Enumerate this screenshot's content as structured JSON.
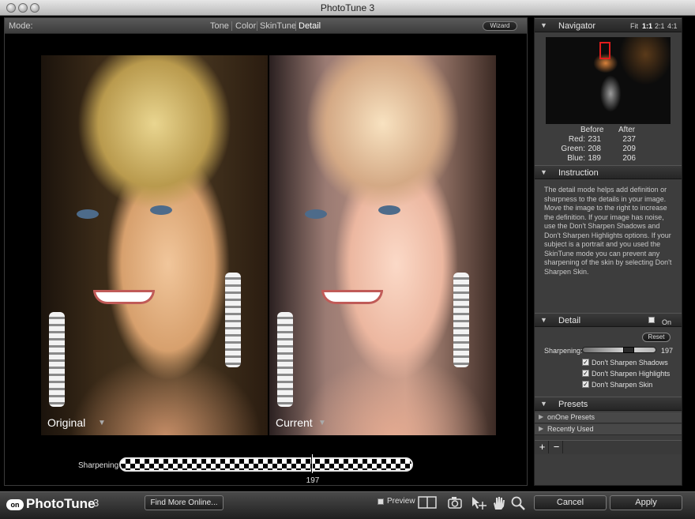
{
  "window": {
    "title": "PhotoTune 3"
  },
  "modebar": {
    "label": "Mode:",
    "tabs": [
      "Tone",
      "Color",
      "SkinTune",
      "Detail"
    ],
    "active_tab": "Detail",
    "wizard": "Wizard"
  },
  "photos": {
    "original_label": "Original",
    "current_label": "Current"
  },
  "slider": {
    "label": "Sharpening",
    "value": "197"
  },
  "navigator": {
    "title": "Navigator",
    "zoom": [
      "Fit",
      "1:1",
      "2:1",
      "4:1"
    ],
    "active_zoom": "1:1",
    "before": "Before",
    "after": "After",
    "rows": [
      {
        "label": "Red:",
        "before": "231",
        "after": "237"
      },
      {
        "label": "Green:",
        "before": "208",
        "after": "209"
      },
      {
        "label": "Blue:",
        "before": "189",
        "after": "206"
      }
    ]
  },
  "instruction": {
    "title": "Instruction",
    "text": "The detail mode helps add definition or sharpness to the details in your image. Move the image to the right to increase the definition. If your image has noise, use the Don't Sharpen Shadows and Don't Sharpen Highlights options. If your subject is a portrait and you used the SkinTune mode you can prevent any sharpening of the skin by selecting Don't Sharpen Skin."
  },
  "detail": {
    "title": "Detail",
    "on_label": "On",
    "reset": "Reset",
    "sharpening_label": "Sharpening:",
    "sharpening_value": "197",
    "options": [
      "Don't Sharpen Shadows",
      "Don't Sharpen Highlights",
      "Don't Sharpen Skin"
    ]
  },
  "presets": {
    "title": "Presets",
    "items": [
      "onOne Presets",
      "Recently Used"
    ]
  },
  "bottombar": {
    "logo_badge": "on",
    "logo_text": "PhotoTune",
    "logo_version": "3",
    "find_more": "Find More Online...",
    "preview": "Preview",
    "cancel": "Cancel",
    "apply": "Apply"
  }
}
